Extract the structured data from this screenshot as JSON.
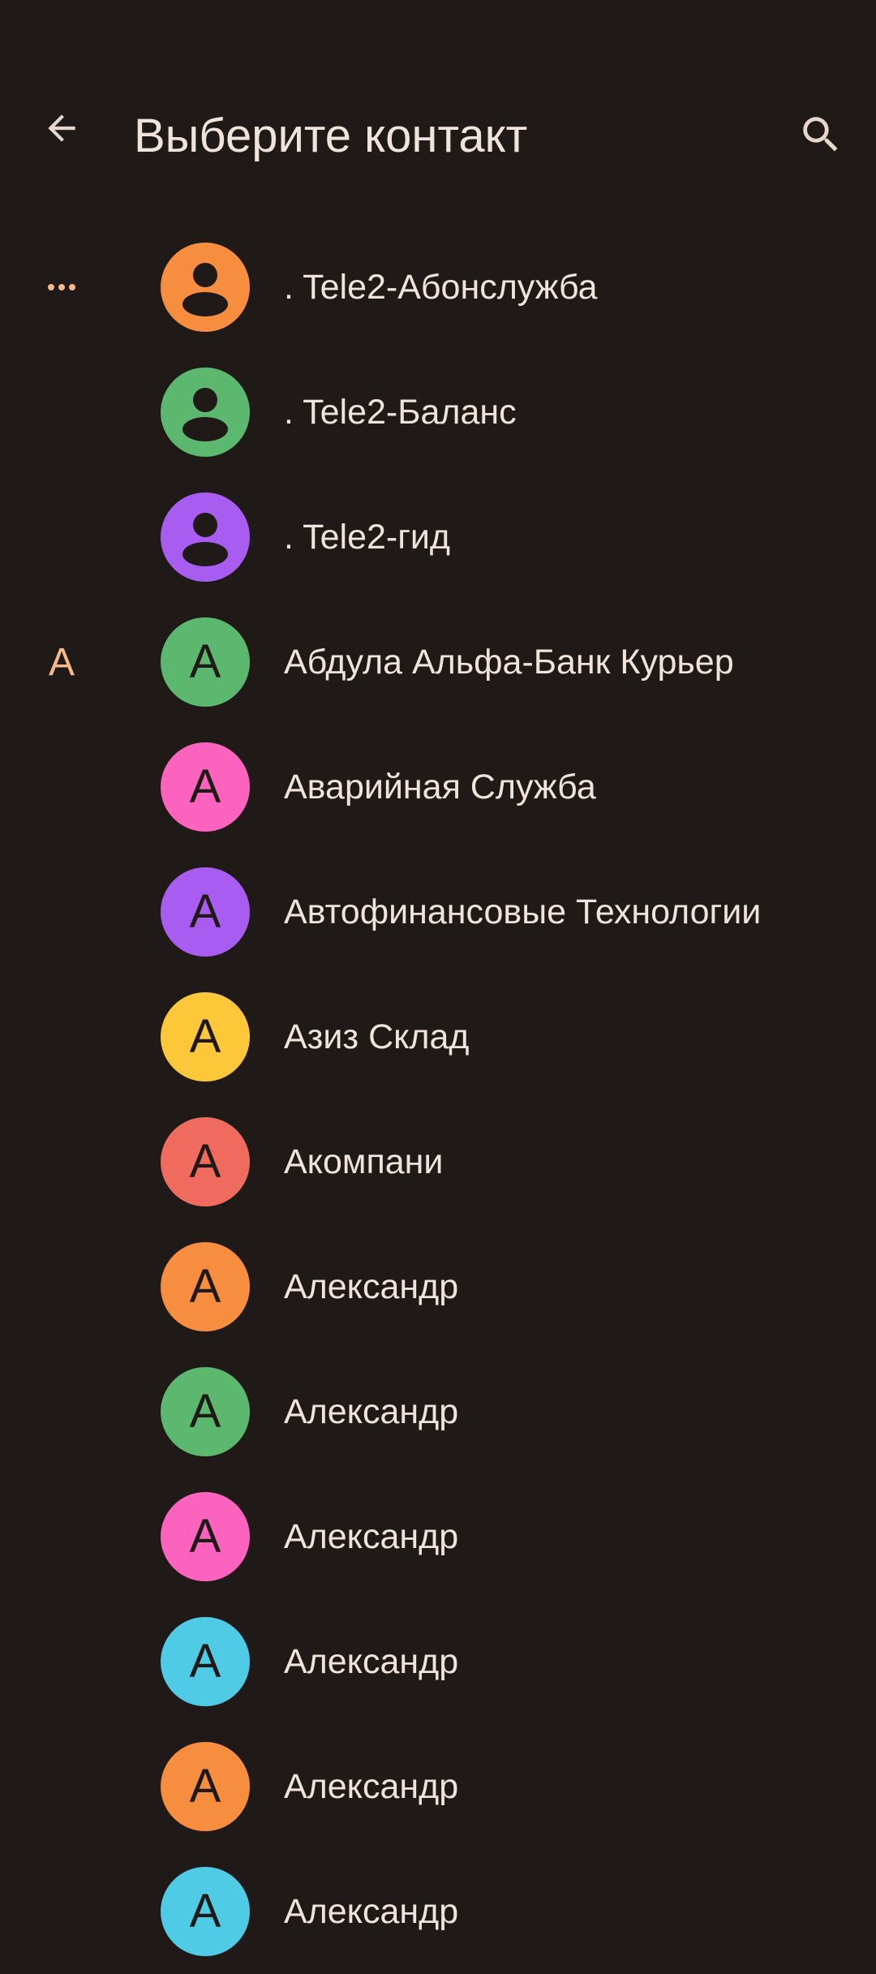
{
  "header": {
    "title": "Выберите контакт",
    "back_icon": "arrow-back-icon",
    "search_icon": "search-icon"
  },
  "contacts": [
    {
      "section": "…",
      "avatar_type": "person",
      "avatar_color": "#f78d3f",
      "initial": "",
      "name": ". Tele2-Абонслужба"
    },
    {
      "section": "",
      "avatar_type": "person",
      "avatar_color": "#5cb86f",
      "initial": "",
      "name": ". Tele2-Баланс"
    },
    {
      "section": "",
      "avatar_type": "person",
      "avatar_color": "#a95cf0",
      "initial": "",
      "name": ". Tele2-гид"
    },
    {
      "section": "А",
      "avatar_type": "letter",
      "avatar_color": "#5cb86f",
      "initial": "А",
      "name": "Абдула Альфа-Банк Курьер"
    },
    {
      "section": "",
      "avatar_type": "letter",
      "avatar_color": "#fb63bf",
      "initial": "А",
      "name": "Аварийная Служба"
    },
    {
      "section": "",
      "avatar_type": "letter",
      "avatar_color": "#a95cf0",
      "initial": "А",
      "name": "Автофинансовые Технологии"
    },
    {
      "section": "",
      "avatar_type": "letter",
      "avatar_color": "#fdc73a",
      "initial": "А",
      "name": "Азиз Склад"
    },
    {
      "section": "",
      "avatar_type": "letter",
      "avatar_color": "#ee6b5d",
      "initial": "А",
      "name": "Акомпани"
    },
    {
      "section": "",
      "avatar_type": "letter",
      "avatar_color": "#f78d3f",
      "initial": "А",
      "name": "Александр"
    },
    {
      "section": "",
      "avatar_type": "letter",
      "avatar_color": "#5cb86f",
      "initial": "А",
      "name": "Александр"
    },
    {
      "section": "",
      "avatar_type": "letter",
      "avatar_color": "#fb63bf",
      "initial": "А",
      "name": "Александр"
    },
    {
      "section": "",
      "avatar_type": "letter",
      "avatar_color": "#4fcbe6",
      "initial": "А",
      "name": "Александр"
    },
    {
      "section": "",
      "avatar_type": "letter",
      "avatar_color": "#f78d3f",
      "initial": "А",
      "name": "Александр"
    },
    {
      "section": "",
      "avatar_type": "letter",
      "avatar_color": "#4fcbe6",
      "initial": "А",
      "name": "Александр"
    }
  ]
}
